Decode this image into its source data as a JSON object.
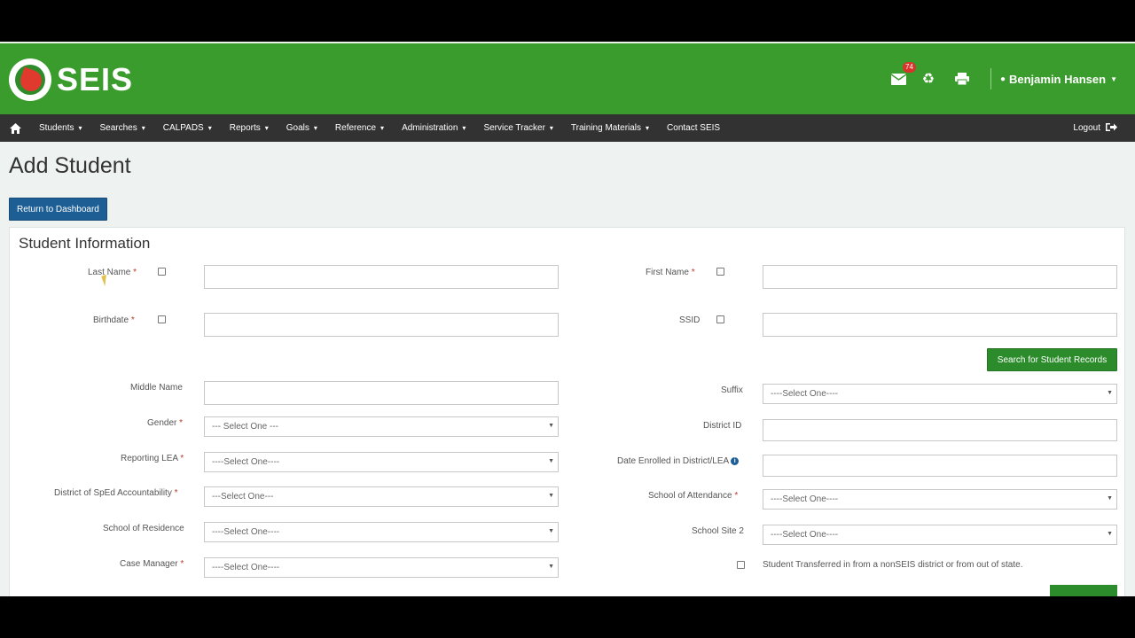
{
  "header": {
    "logo_text": "SEIS",
    "mail_badge": "74",
    "user_name": "Benjamin Hansen"
  },
  "nav": {
    "items": [
      "Students",
      "Searches",
      "CALPADS",
      "Reports",
      "Goals",
      "Reference",
      "Administration",
      "Service Tracker",
      "Training Materials",
      "Contact SEIS"
    ],
    "logout": "Logout"
  },
  "page": {
    "title": "Add Student",
    "return_button": "Return to Dashboard",
    "panel_title": "Student Information"
  },
  "form": {
    "last_name": "Last Name",
    "first_name": "First Name",
    "birthdate": "Birthdate",
    "ssid": "SSID",
    "search_button": "Search for Student Records",
    "middle_name": "Middle Name",
    "suffix": "Suffix",
    "suffix_value": "----Select One----",
    "gender": "Gender",
    "gender_value": "--- Select One ---",
    "district_id": "District ID",
    "reporting_lea": "Reporting LEA",
    "reporting_lea_value": "----Select One----",
    "date_enrolled": "Date Enrolled in District/LEA",
    "district_sped": "District of SpEd Accountability",
    "district_sped_value": "---Select One---",
    "school_attendance": "School of Attendance",
    "school_attendance_value": "----Select One----",
    "school_residence": "School of Residence",
    "school_residence_value": "----Select One----",
    "school_site2": "School Site 2",
    "school_site2_value": "----Select One----",
    "case_manager": "Case Manager",
    "case_manager_value": "----Select One----",
    "transfer_text": "Student Transferred in from a nonSEIS district or from out of state.",
    "required_mark": "*"
  },
  "colors": {
    "header_green": "#3a9c2c",
    "nav_dark": "#323232",
    "button_blue": "#1d5f95",
    "button_green": "#2c8c2c",
    "required_red": "#c0392b"
  }
}
